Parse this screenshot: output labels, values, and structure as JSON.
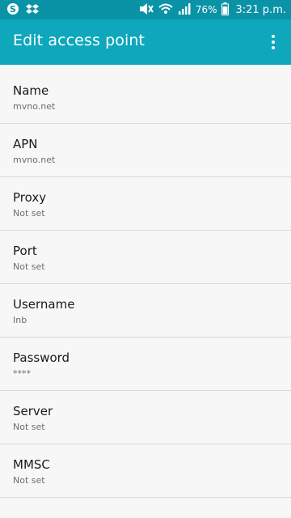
{
  "status_bar": {
    "left_icons": [
      "skype-icon",
      "dropbox-icon"
    ],
    "right_icons": [
      "mute-icon",
      "wifi-icon",
      "signal-icon",
      "battery-icon"
    ],
    "battery_text": "76%",
    "time": "3:21 p.m.",
    "bar_color": "#0a93a6"
  },
  "app_bar": {
    "title": "Edit access point",
    "color": "#0ea7bc",
    "menu_icon": "more-vert-icon"
  },
  "settings": [
    {
      "label": "Name",
      "value": "mvno.net"
    },
    {
      "label": "APN",
      "value": "mvno.net"
    },
    {
      "label": "Proxy",
      "value": "Not set"
    },
    {
      "label": "Port",
      "value": "Not set"
    },
    {
      "label": "Username",
      "value": "Inb"
    },
    {
      "label": "Password",
      "value": "****"
    },
    {
      "label": "Server",
      "value": "Not set"
    },
    {
      "label": "MMSC",
      "value": "Not set"
    }
  ]
}
